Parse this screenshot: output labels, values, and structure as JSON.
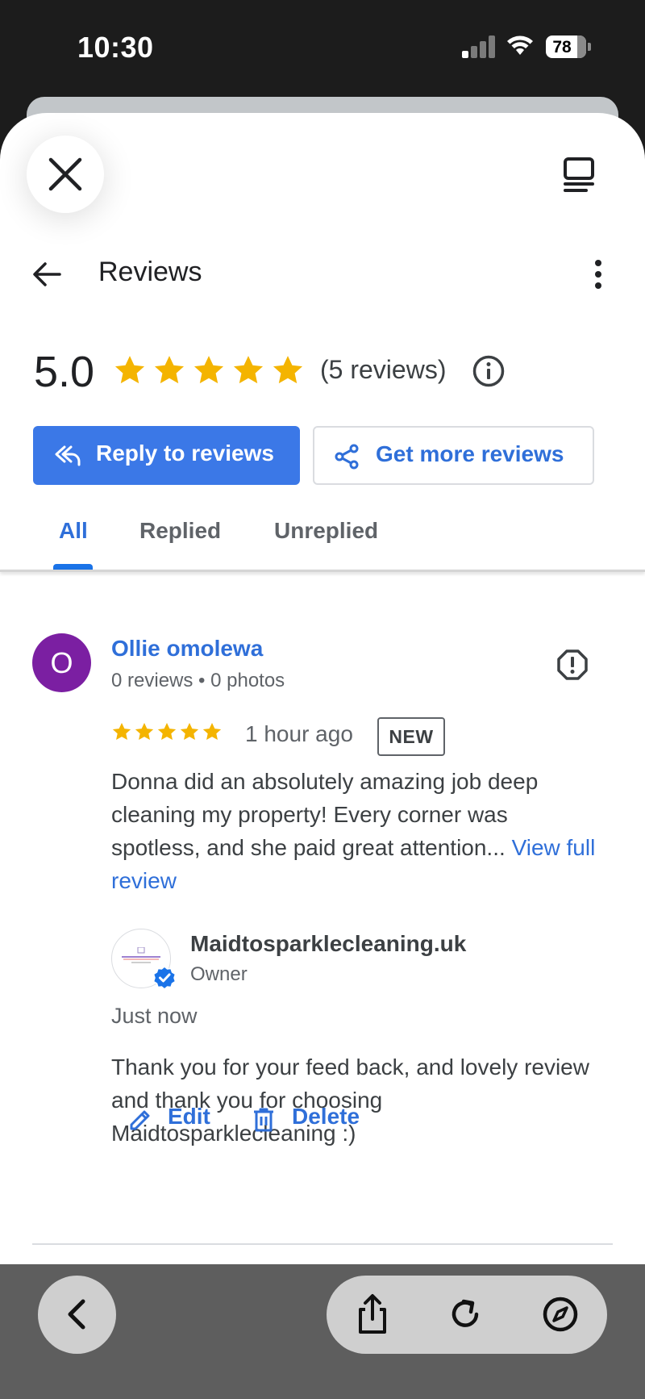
{
  "status_bar": {
    "time": "10:30",
    "battery": "78"
  },
  "header": {
    "title": "Reviews"
  },
  "rating": {
    "value": "5.0",
    "stars": 5,
    "count_text": "(5 reviews)"
  },
  "buttons": {
    "reply": "Reply to reviews",
    "get_more": "Get more reviews"
  },
  "tabs": [
    {
      "label": "All",
      "active": true
    },
    {
      "label": "Replied"
    },
    {
      "label": "Unreplied"
    }
  ],
  "review": {
    "avatar_letter": "O",
    "avatar_color": "#7b1fa2",
    "author": "Ollie omolewa",
    "meta": "0 reviews • 0 photos",
    "stars": 5,
    "time": "1 hour ago",
    "badge": "NEW",
    "text": "Donna did an absolutely amazing job deep cleaning my property! Every corner was spotless, and she paid great attention...",
    "view_full": "View full review"
  },
  "reply": {
    "owner_name": "Maidtosparklecleaning.uk",
    "owner_role": "Owner",
    "time": "Just now",
    "text": "Thank you for your feed back, and lovely review and thank you for choosing Maidtosparklecleaning :)",
    "edit_label": "Edit",
    "delete_label": "Delete"
  },
  "colors": {
    "accent": "#1a73e8",
    "star": "#f4b400"
  }
}
